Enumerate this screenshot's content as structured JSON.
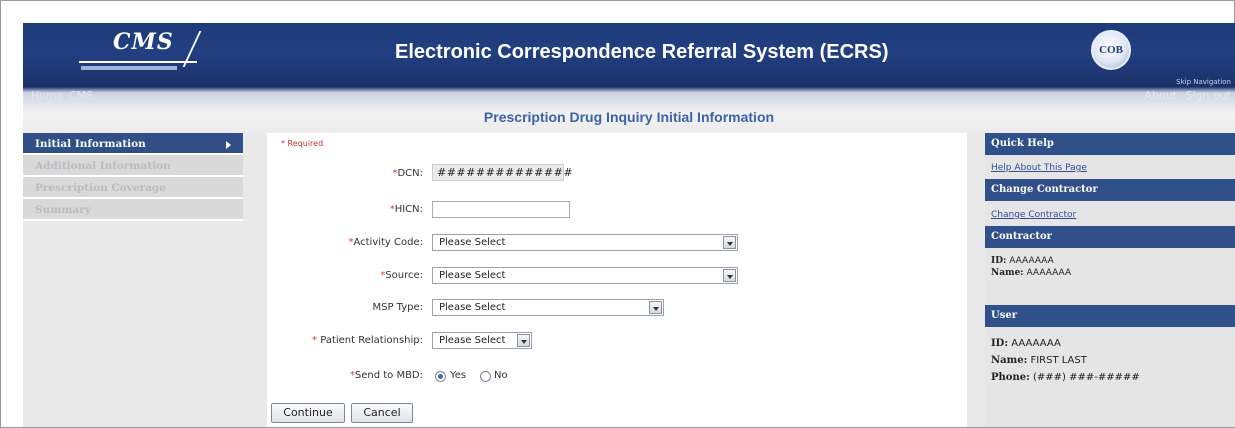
{
  "header": {
    "logo_text": "CMS",
    "app_title": "Electronic Correspondence Referral System (ECRS)",
    "cob_logo_text": "COB",
    "skip_nav": "Skip Navigation"
  },
  "topnav": {
    "home": "Home",
    "cms": "CMS",
    "about": "About",
    "sign_out": "Sign out"
  },
  "page_heading": "Prescription Drug Inquiry Initial Information",
  "sidebar": {
    "items": [
      {
        "label": "Initial Information",
        "active": true
      },
      {
        "label": "Additional Information",
        "active": false
      },
      {
        "label": "Prescription Coverage",
        "active": false
      },
      {
        "label": "Summary",
        "active": false
      }
    ]
  },
  "form": {
    "required_note": "* Required",
    "fields": {
      "dcn": {
        "label": "DCN:",
        "value": "##############"
      },
      "hicn": {
        "label": "HICN:",
        "value": ""
      },
      "activity_code": {
        "label": "Activity Code:",
        "selected": "Please Select"
      },
      "source": {
        "label": "Source:",
        "selected": "Please Select"
      },
      "msp_type": {
        "label": "MSP Type:",
        "selected": "Please Select"
      },
      "patient_relationship": {
        "label": "Patient Relationship:",
        "selected": "Please Select"
      },
      "send_to_mbd": {
        "label": "Send to MBD:",
        "yes": "Yes",
        "no": "No",
        "selected": "Yes"
      }
    },
    "continue_label": "Continue",
    "cancel_label": "Cancel"
  },
  "right_panel": {
    "quick_help": {
      "title": "Quick Help",
      "link": "Help About This Page"
    },
    "change_contractor": {
      "title": "Change Contractor",
      "link": "Change Contractor"
    },
    "contractor": {
      "title": "Contractor",
      "id_label": "ID:",
      "id_value": "AAAAAAA",
      "name_label": "Name:",
      "name_value": "AAAAAAA"
    },
    "user": {
      "title": "User",
      "id_label": "ID:",
      "id_value": "AAAAAAA",
      "name_label": "Name:",
      "name_value": "FIRST LAST",
      "phone_label": "Phone:",
      "phone_value": "(###) ###-#####"
    }
  },
  "colors": {
    "banner": "#1d3a78",
    "accent": "#30508a",
    "heading": "#3b63a8",
    "required": "#d23b2b"
  }
}
